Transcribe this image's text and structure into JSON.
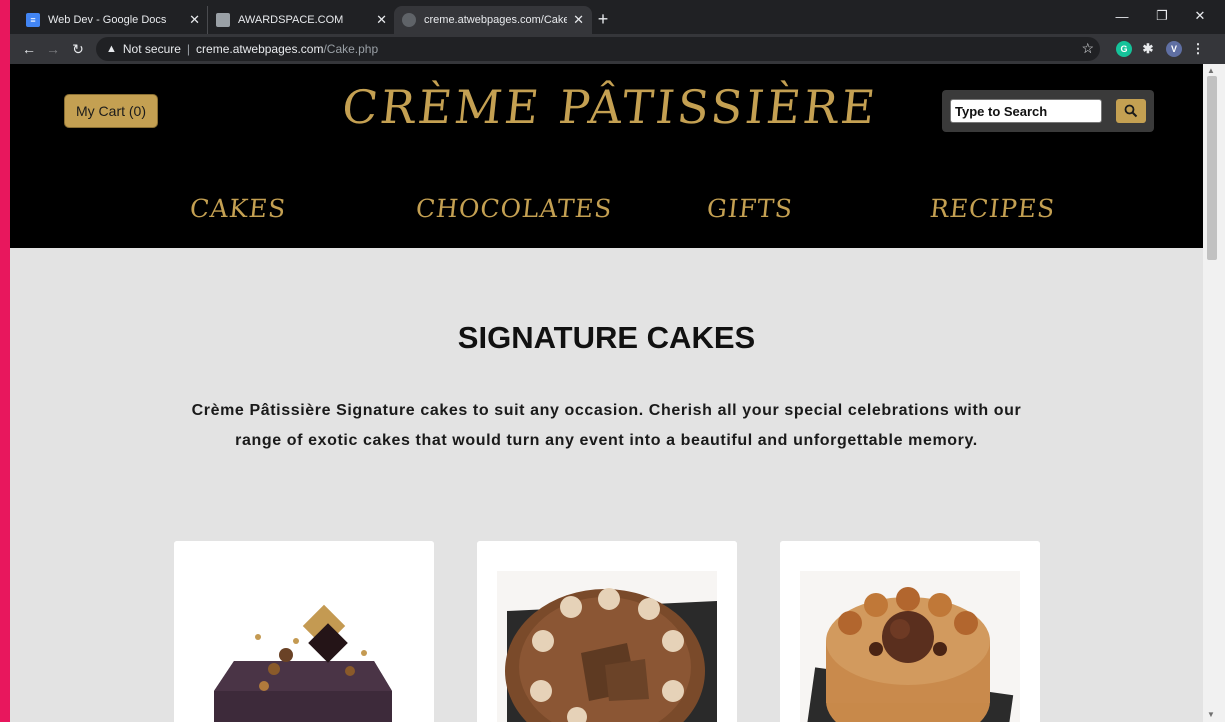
{
  "browser": {
    "tabs": [
      {
        "title": "Web Dev - Google Docs",
        "favicon": "docs-icon",
        "active": false
      },
      {
        "title": "AWARDSPACE.COM",
        "favicon": "awardspace-icon",
        "active": false
      },
      {
        "title": "creme.atwebpages.com/Cake.php",
        "favicon": "globe-icon",
        "active": true
      }
    ],
    "new_tab_label": "+",
    "security_label": "Not secure",
    "url_host": "creme.atwebpages.com",
    "url_path": "/Cake.php",
    "profile_initial": "V",
    "grammarly_initial": "G"
  },
  "site": {
    "cart_label": "My Cart (0)",
    "brand_name": "CRÈME PÂTISSIÈRE",
    "search_placeholder": "Type to Search",
    "nav": [
      "CAKES",
      "CHOCOLATES",
      "GIFTS",
      "RECIPES"
    ]
  },
  "content": {
    "heading": "SIGNATURE CAKES",
    "intro": "Crème Pâtissière Signature cakes to suit any occasion. Cherish all your special celebrations with our range of exotic cakes that would turn any event into a beautiful and unforgettable memory."
  },
  "colors": {
    "accent_gold": "#c4a052",
    "header_bg": "#000000",
    "page_bg": "#e3e3e3",
    "frame_pink": "#e8175d"
  }
}
